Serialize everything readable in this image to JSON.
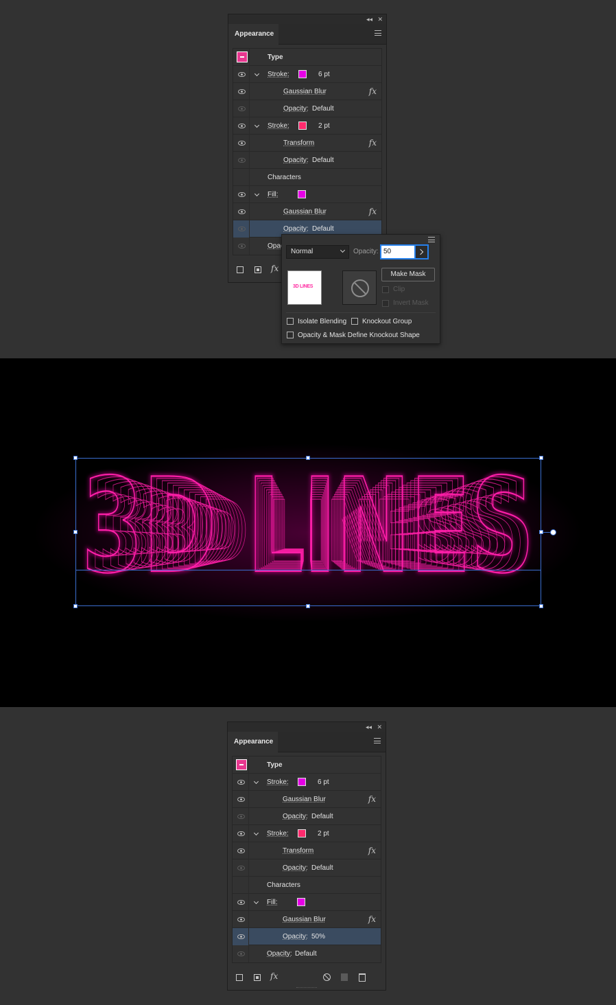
{
  "panel": {
    "title": "Appearance",
    "collapse_label": "◂◂",
    "close_label": "✕"
  },
  "rows_top": [
    {
      "kind": "header",
      "label": "Type"
    },
    {
      "kind": "attr",
      "eye": true,
      "expand": true,
      "label": "Stroke:",
      "swatch": "#e600e6",
      "value": "6 pt"
    },
    {
      "kind": "effect",
      "eye": true,
      "label": "Gaussian Blur",
      "fx": true
    },
    {
      "kind": "opacity",
      "eye": "dim",
      "label": "Opacity:",
      "value": "Default"
    },
    {
      "kind": "attr",
      "eye": true,
      "expand": true,
      "label": "Stroke:",
      "swatch": "#ff2a6d",
      "value": "2 pt"
    },
    {
      "kind": "effect",
      "eye": true,
      "label": "Transform",
      "fx": true
    },
    {
      "kind": "opacity",
      "eye": "dim",
      "label": "Opacity:",
      "value": "Default"
    },
    {
      "kind": "group",
      "label": "Characters"
    },
    {
      "kind": "attr",
      "eye": true,
      "expand": true,
      "label": "Fill:",
      "swatch": "#e600e6",
      "value": ""
    },
    {
      "kind": "effect",
      "eye": true,
      "label": "Gaussian Blur",
      "fx": true
    },
    {
      "kind": "opacity",
      "eye": "dim",
      "label": "Opacity:",
      "value": "Default",
      "selected": true
    },
    {
      "kind": "opacity-root",
      "eye": "dim",
      "label": "Opac",
      "value": ""
    }
  ],
  "rows_bottom": [
    {
      "kind": "header",
      "label": "Type"
    },
    {
      "kind": "attr",
      "eye": true,
      "expand": true,
      "label": "Stroke:",
      "swatch": "#e600e6",
      "value": "6 pt"
    },
    {
      "kind": "effect",
      "eye": true,
      "label": "Gaussian Blur",
      "fx": true
    },
    {
      "kind": "opacity",
      "eye": "dim",
      "label": "Opacity:",
      "value": "Default"
    },
    {
      "kind": "attr",
      "eye": true,
      "expand": true,
      "label": "Stroke:",
      "swatch": "#ff2a6d",
      "value": "2 pt"
    },
    {
      "kind": "effect",
      "eye": true,
      "label": "Transform",
      "fx": true
    },
    {
      "kind": "opacity",
      "eye": "dim",
      "label": "Opacity:",
      "value": "Default"
    },
    {
      "kind": "group",
      "label": "Characters"
    },
    {
      "kind": "attr",
      "eye": true,
      "expand": true,
      "label": "Fill:",
      "swatch": "#e600e6",
      "value": ""
    },
    {
      "kind": "effect",
      "eye": true,
      "label": "Gaussian Blur",
      "fx": true
    },
    {
      "kind": "opacity",
      "eye": true,
      "label": "Opacity:",
      "value": "50%",
      "selected": true
    },
    {
      "kind": "opacity-root",
      "eye": "dim",
      "label": "Opacity:",
      "value": "Default"
    }
  ],
  "footer_icons": [
    "new-stroke-icon",
    "new-fill-icon",
    "add-effect-icon",
    "clear-appearance-icon",
    "duplicate-icon",
    "delete-icon"
  ],
  "fx_label": "fx",
  "popup": {
    "blend_mode": "Normal",
    "opacity_label": "Opacity:",
    "opacity_value": "50",
    "thumb_text": "3D LINES",
    "make_mask": "Make Mask",
    "clip": "Clip",
    "invert_mask": "Invert Mask",
    "isolate_blending": "Isolate Blending",
    "knockout_group": "Knockout Group",
    "opacity_mask_knockout": "Opacity & Mask Define Knockout Shape"
  },
  "artwork": {
    "text": "3D LINES",
    "neon_color": "#ff1fa8",
    "glow_color": "#ff00b4",
    "selection_color": "#3b6fd1"
  }
}
